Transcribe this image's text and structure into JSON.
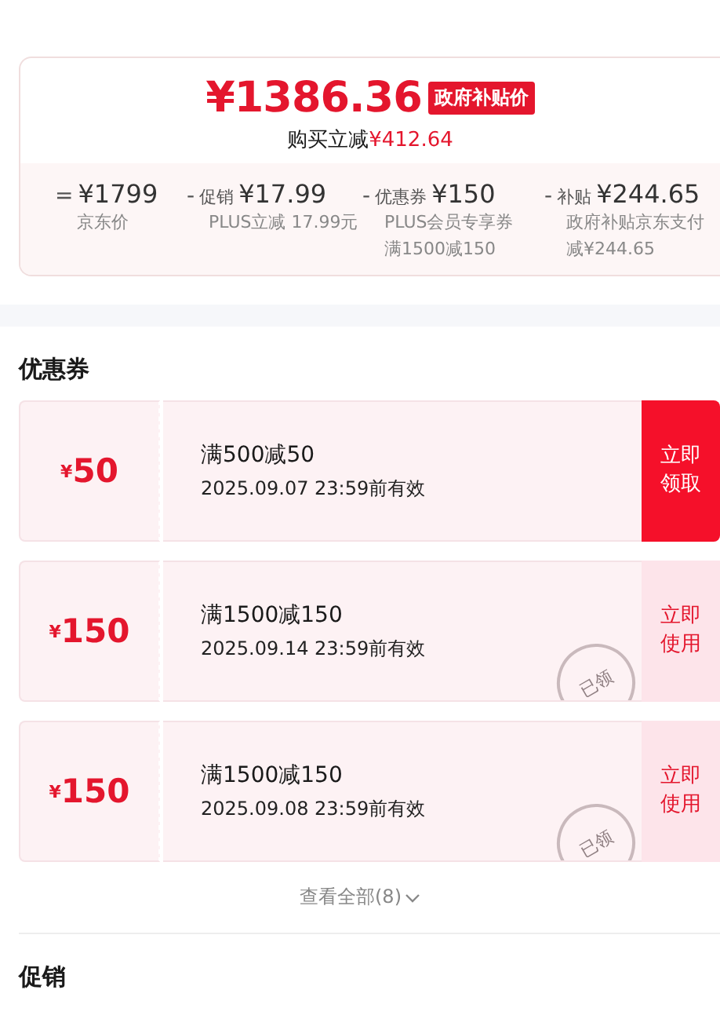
{
  "price_card": {
    "final_price": "¥1386.36",
    "price_tag": "政府补贴价",
    "saving_label": "购买立减",
    "saving_amount": "¥412.64",
    "breakdown": [
      {
        "operator": "=",
        "amount": "¥1799",
        "notes": [
          "京东价"
        ]
      },
      {
        "operator": "-",
        "label": "促销",
        "amount": "¥17.99",
        "notes": [
          "PLUS立减 17.99元"
        ]
      },
      {
        "operator": "-",
        "label": "优惠券",
        "amount": "¥150",
        "notes": [
          "PLUS会员专享券",
          "满1500减150"
        ]
      },
      {
        "operator": "-",
        "label": "补贴",
        "amount": "¥244.65",
        "notes": [
          "政府补贴京东支付",
          "减¥244.65"
        ]
      }
    ]
  },
  "coupons": {
    "title": "优惠券",
    "items": [
      {
        "currency": "¥",
        "value": "50",
        "condition": "满500减50",
        "validity": "2025.09.07 23:59前有效",
        "claimed": false,
        "action": "立即领取",
        "kind": "claim"
      },
      {
        "currency": "¥",
        "value": "150",
        "condition": "满1500减150",
        "validity": "2025.09.14 23:59前有效",
        "claimed": true,
        "stamp": "已领",
        "action": "立即使用",
        "kind": "use"
      },
      {
        "currency": "¥",
        "value": "150",
        "condition": "满1500减150",
        "validity": "2025.09.08 23:59前有效",
        "claimed": true,
        "stamp": "已领",
        "action": "立即使用",
        "kind": "use"
      }
    ],
    "view_all": "查看全部(8)"
  },
  "promotions": {
    "title": "促销"
  }
}
